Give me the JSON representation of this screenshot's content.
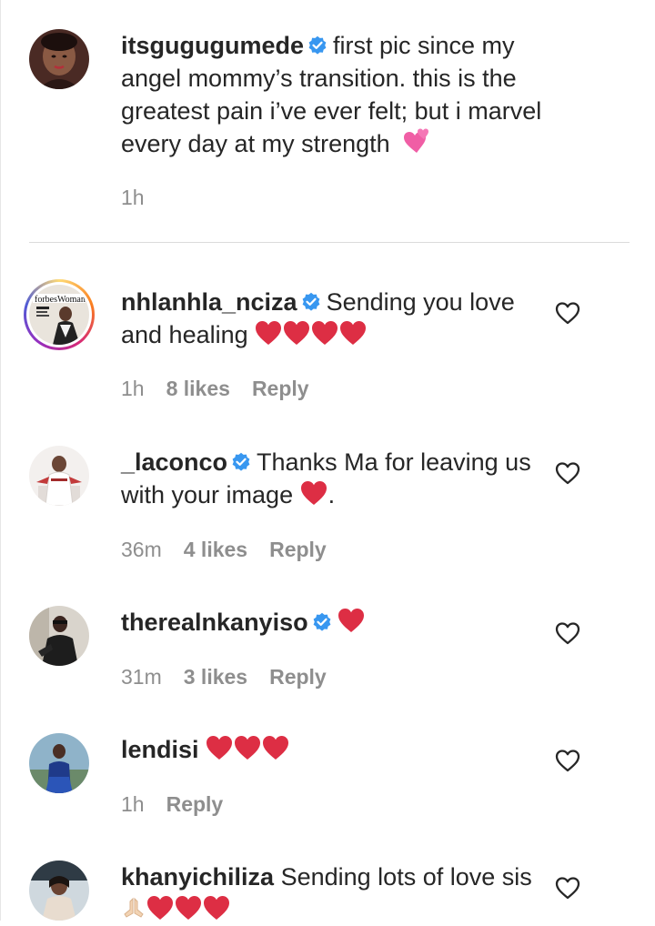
{
  "caption": {
    "username": "itsgugugumede",
    "text": "first pic since my angel mommy’s transition. this is the greatest pain i’ve ever felt; but i marvel every day at my strength",
    "emoji": "two-hearts",
    "time": "1h"
  },
  "comments": [
    {
      "username": "nhlanhla_nciza",
      "verified": true,
      "text": "Sending you love and healing",
      "emoji": "❤️❤️❤️❤️",
      "time": "1h",
      "likes": "8 likes",
      "reply": "Reply"
    },
    {
      "username": "_laconco",
      "verified": true,
      "text": "Thanks Ma for leaving us with your image",
      "emoji": "❤️",
      "suffix": ".",
      "time": "36m",
      "likes": "4 likes",
      "reply": "Reply"
    },
    {
      "username": "therealnkanyiso",
      "verified": true,
      "text": "",
      "emoji": "❤️",
      "time": "31m",
      "likes": "3 likes",
      "reply": "Reply"
    },
    {
      "username": "lendisi",
      "verified": false,
      "text": "",
      "emoji": "❤️❤️❤️",
      "time": "1h",
      "reply": "Reply"
    },
    {
      "username": "khanyichiliza",
      "verified": false,
      "text": "Sending lots of love sis",
      "emoji": "🙏🏻❤️❤️❤️",
      "time": "",
      "reply": ""
    }
  ],
  "colors": {
    "verified": "#3897f0",
    "heart_red": "#dd2e44",
    "meta_gray": "#8e8e8e",
    "text": "#262626"
  },
  "icons": {
    "like": "heart-outline-icon",
    "verified": "verified-badge-icon"
  }
}
